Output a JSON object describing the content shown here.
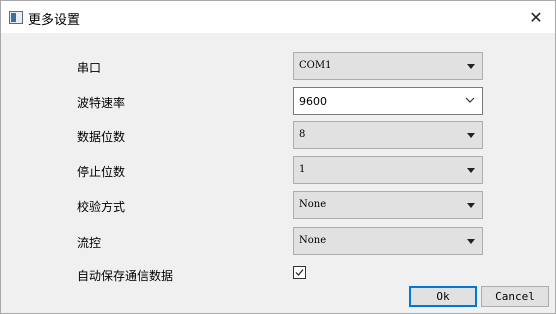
{
  "window": {
    "title": "更多设置",
    "close_glyph": "✕"
  },
  "fields": {
    "serial_port": {
      "label": "串口",
      "value": "COM1"
    },
    "baud_rate": {
      "label": "波特速率",
      "value": "9600"
    },
    "data_bits": {
      "label": "数据位数",
      "value": "8"
    },
    "stop_bits": {
      "label": "停止位数",
      "value": "1"
    },
    "parity": {
      "label": "校验方式",
      "value": "None"
    },
    "flow_control": {
      "label": "流控",
      "value": "None"
    },
    "auto_save": {
      "label": "自动保存通信数据",
      "checked": true
    }
  },
  "buttons": {
    "ok": "Ok",
    "cancel": "Cancel"
  }
}
